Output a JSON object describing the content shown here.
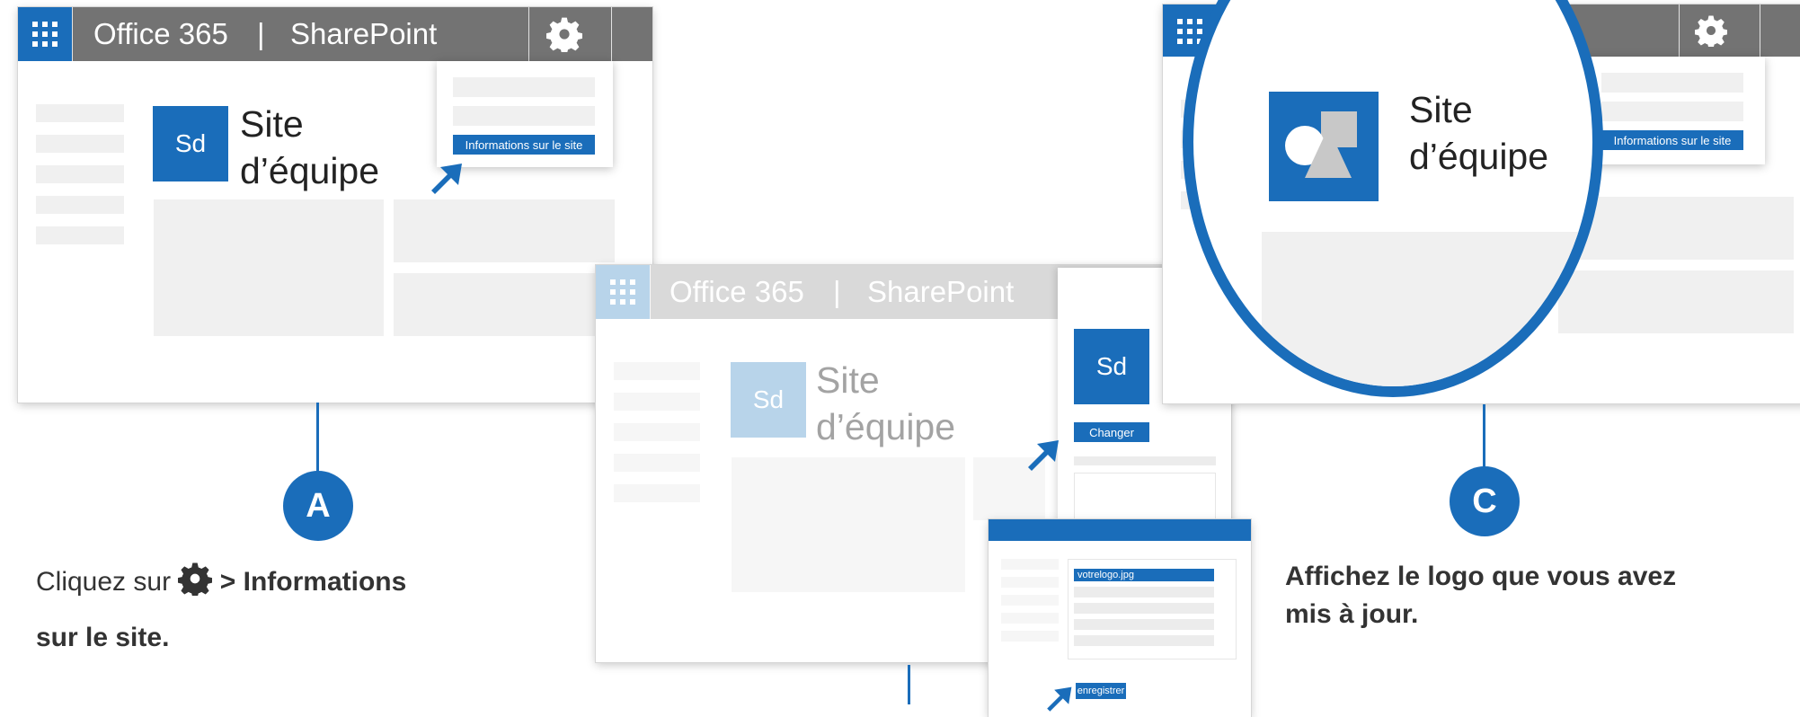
{
  "header": {
    "office_label": "Office 365",
    "separator": "|",
    "product_label": "SharePoint"
  },
  "site": {
    "logo_initials": "Sd",
    "name_line1": "Site",
    "name_line2": "d’équipe"
  },
  "menu": {
    "site_info_label": "Informations sur le site"
  },
  "panel": {
    "change_label": "Changer",
    "file_name": "votrelogo.jpg",
    "save_label": "enregistrer"
  },
  "steps": {
    "a": {
      "badge": "A",
      "text_before_icon": "Cliquez sur",
      "text_after_icon": ">",
      "bold_part1": "Informations",
      "bold_part2": "sur le site."
    },
    "c": {
      "badge": "C",
      "line1": "Affichez le logo que vous avez",
      "line2": "mis à jour."
    }
  },
  "icons": {
    "app_launcher": "waffle-icon",
    "settings": "gear-icon",
    "pointer": "arrow-pointer-icon",
    "generic_logo": "shapes-logo-icon"
  },
  "colors": {
    "accent": "#1a6dba",
    "header_gray": "#737373",
    "light_accent": "#b8d4ea"
  }
}
